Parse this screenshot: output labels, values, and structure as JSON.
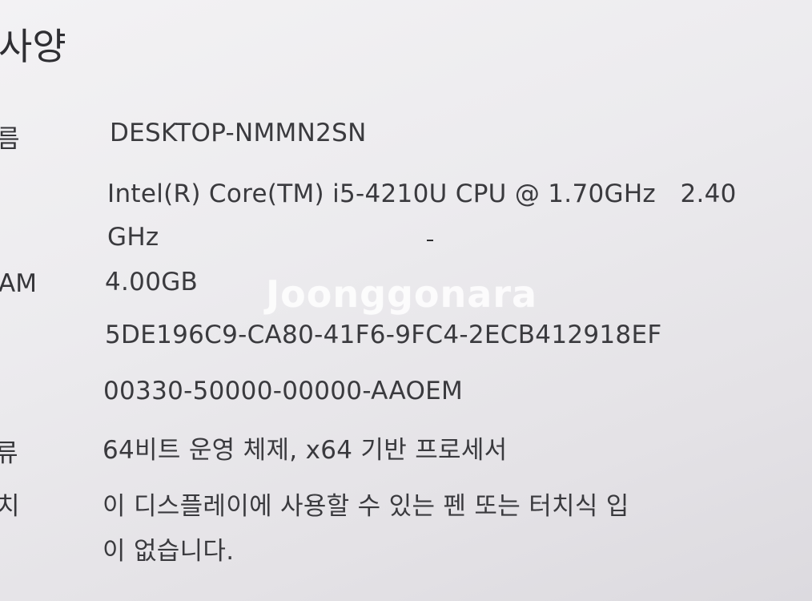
{
  "section_title": "사양",
  "rows": {
    "device_name": {
      "label": "름",
      "value": "DESKTOP-NMMN2SN"
    },
    "processor": {
      "value_line1": "Intel(R) Core(TM) i5-4210U CPU @ 1.70GHz   2.40",
      "value_line2": "GHz"
    },
    "ram": {
      "label": "AM",
      "value": "4.00GB"
    },
    "device_id": {
      "value": "5DE196C9-CA80-41F6-9FC4-2ECB412918EF"
    },
    "product_id": {
      "value": "00330-50000-00000-AAOEM"
    },
    "system_type": {
      "label": "류",
      "value": "64비트 운영 체제, x64 기반 프로세서"
    },
    "pen_touch": {
      "label": "치",
      "value_line1": "이 디스플레이에 사용할 수 있는 펜 또는 터치식 입",
      "value_line2": "이 없습니다."
    }
  },
  "watermark": "Joonggonara"
}
